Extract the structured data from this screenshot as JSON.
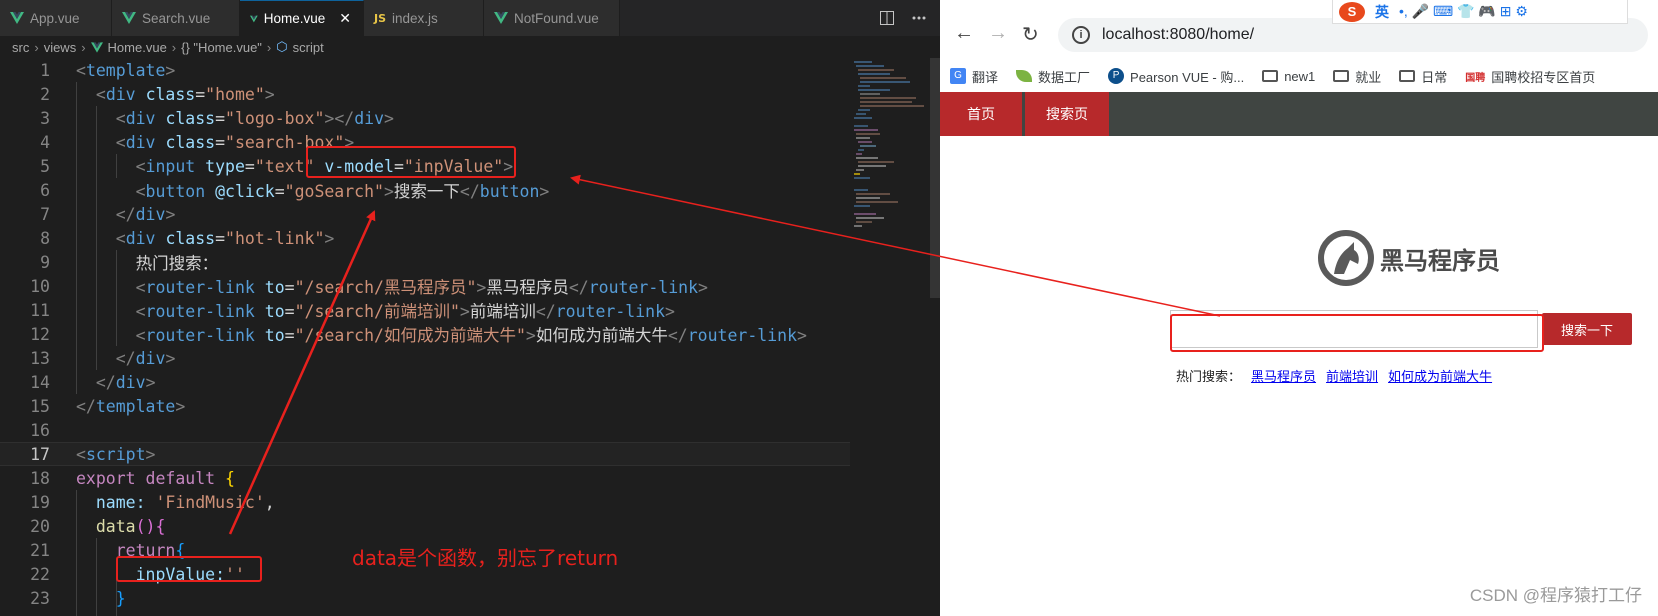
{
  "editor": {
    "tabs": [
      {
        "label": "App.vue",
        "type": "vue",
        "active": false
      },
      {
        "label": "Search.vue",
        "type": "vue",
        "active": false
      },
      {
        "label": "Home.vue",
        "type": "vue",
        "active": true
      },
      {
        "label": "index.js",
        "type": "js",
        "active": false
      },
      {
        "label": "NotFound.vue",
        "type": "vue",
        "active": false
      }
    ],
    "js_badge": "JS",
    "close_glyph": "✕",
    "breadcrumb": [
      "src",
      "views",
      "Home.vue",
      "{} \"Home.vue\"",
      "script"
    ],
    "current_line": 17,
    "lines": [
      {
        "n": "1"
      },
      {
        "n": "2"
      },
      {
        "n": "3"
      },
      {
        "n": "4"
      },
      {
        "n": "5"
      },
      {
        "n": "6"
      },
      {
        "n": "7"
      },
      {
        "n": "8"
      },
      {
        "n": "9"
      },
      {
        "n": "10"
      },
      {
        "n": "11"
      },
      {
        "n": "12"
      },
      {
        "n": "13"
      },
      {
        "n": "14"
      },
      {
        "n": "15"
      },
      {
        "n": "16"
      },
      {
        "n": "17"
      },
      {
        "n": "18"
      },
      {
        "n": "19"
      },
      {
        "n": "20"
      },
      {
        "n": "21"
      },
      {
        "n": "22"
      },
      {
        "n": "23"
      }
    ],
    "code": {
      "template": "template",
      "div": "div",
      "input": "input",
      "button": "button",
      "router_link": "router-link",
      "script": "script",
      "class_attr": "class",
      "type_attr": "type",
      "vmodel_attr": "v-model",
      "click_attr": "@click",
      "to_attr": "to",
      "home_cls": "\"home\"",
      "logo_cls": "\"logo-box\"",
      "search_cls": "\"search-box\"",
      "hot_cls": "\"hot-link\"",
      "text_val": "\"text\"",
      "inp_val": "\"inpValue\"",
      "go_val": "\"goSearch\"",
      "btn_text": "搜索一下",
      "hot_text": "热门搜索：",
      "link1_to": "\"/search/黑马程序员\"",
      "link1_text": "黑马程序员",
      "link2_to": "\"/search/前端培训\"",
      "link2_text": "前端培训",
      "link3_to": "\"/search/如何成为前端大牛\"",
      "link3_text": "如何成为前端大牛",
      "export": "export",
      "default": "default",
      "name_key": "name:",
      "name_val": "'FindMusic'",
      "data_fn": "data",
      "return": "return",
      "inp_key": "inpValue:",
      "empty_str": "''"
    }
  },
  "browser": {
    "url": "localhost:8080/home/",
    "ime": {
      "logo": "S",
      "lang": "英",
      "items": "•, 🎤 ⌨ 👕 🎮 ⊞ ⚙"
    },
    "bookmarks": [
      {
        "label": "翻译",
        "icon": "translate-icon"
      },
      {
        "label": "数据工厂",
        "icon": "leaf-icon"
      },
      {
        "label": "Pearson VUE - 购...",
        "icon": "pearson-icon"
      },
      {
        "label": "new1",
        "icon": "folder-icon"
      },
      {
        "label": "就业",
        "icon": "folder-icon"
      },
      {
        "label": "日常",
        "icon": "folder-icon"
      },
      {
        "label": "国聘校招专区首页",
        "icon": "guopin-icon"
      }
    ],
    "site_nav": [
      "首页",
      "搜索页"
    ],
    "logo_text": "黑马程序员",
    "search_button": "搜索一下",
    "hot_label": "热门搜索：",
    "hot_links": [
      "黑马程序员",
      "前端培训",
      "如何成为前端大牛"
    ],
    "watermark": "CSDN @程序猿打工仔"
  },
  "annotation": {
    "note": "data是个函数，别忘了return",
    "color": "#e8211d"
  }
}
